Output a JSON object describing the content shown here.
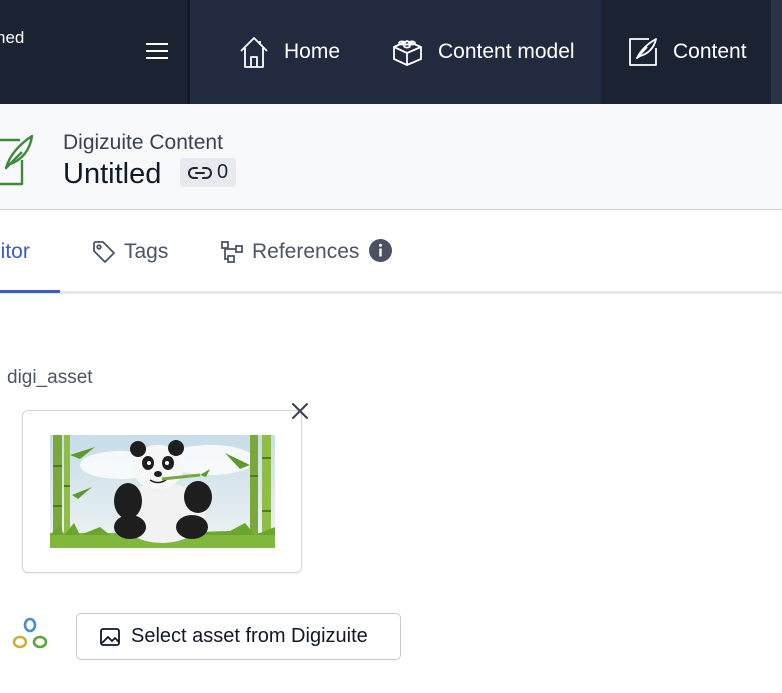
{
  "topbar": {
    "brand_text": "ned",
    "nav": [
      {
        "label": "Home",
        "icon": "home-icon"
      },
      {
        "label": "Content model",
        "icon": "content-model-icon"
      },
      {
        "label": "Content",
        "icon": "content-icon"
      }
    ],
    "active_nav": "Content"
  },
  "header": {
    "subtitle": "Digizuite Content",
    "title": "Untitled",
    "links_count": "0"
  },
  "tabs": [
    {
      "label": "litor",
      "active": true
    },
    {
      "label": "Tags",
      "icon": "tag-icon"
    },
    {
      "label": "References",
      "icon": "references-icon"
    }
  ],
  "field": {
    "label": "digi_asset",
    "asset_image": "panda eating bamboo"
  },
  "select_button": {
    "label": "Select asset from Digizuite"
  },
  "colors": {
    "topbar_bg": "#212a3e",
    "active_tab": "#3b5bc9",
    "leaf_green": "#3e8a3a"
  }
}
